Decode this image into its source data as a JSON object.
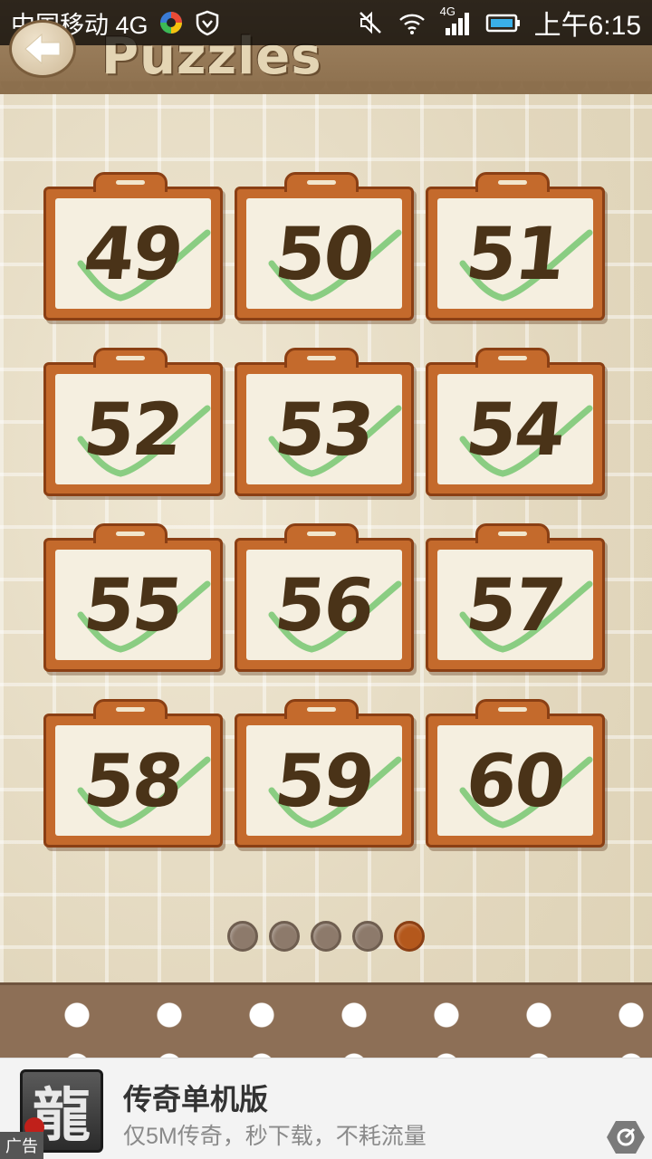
{
  "status_bar": {
    "carrier": "中国移动 4G",
    "network_badge": "4G",
    "time": "上午6:15",
    "icons": [
      "colorful-app-icon",
      "shield-heart-icon",
      "mute-icon",
      "wifi-icon",
      "signal-icon",
      "battery-icon"
    ]
  },
  "header": {
    "title": "Puzzles",
    "back_icon": "back-arrow-icon"
  },
  "puzzles": [
    {
      "number": "49",
      "completed": true
    },
    {
      "number": "50",
      "completed": true
    },
    {
      "number": "51",
      "completed": true
    },
    {
      "number": "52",
      "completed": true
    },
    {
      "number": "53",
      "completed": true
    },
    {
      "number": "54",
      "completed": true
    },
    {
      "number": "55",
      "completed": true
    },
    {
      "number": "56",
      "completed": true
    },
    {
      "number": "57",
      "completed": true
    },
    {
      "number": "58",
      "completed": true
    },
    {
      "number": "59",
      "completed": true
    },
    {
      "number": "60",
      "completed": true
    }
  ],
  "pagination": {
    "pages": 5,
    "current_page": 5
  },
  "ad": {
    "logo_char": "龍",
    "tag": "广告",
    "title": "传奇单机版",
    "subtitle": "仅5M传奇，秒下载，不耗流量",
    "open_icon": "open-external-icon"
  },
  "colors": {
    "header_brown": "#8c6f4d",
    "card_orange": "#c46a2c",
    "number_brown": "#4a3318",
    "check_green": "#6fc46a",
    "active_dot": "#b4581c",
    "inactive_dot": "#8d7a6b"
  }
}
